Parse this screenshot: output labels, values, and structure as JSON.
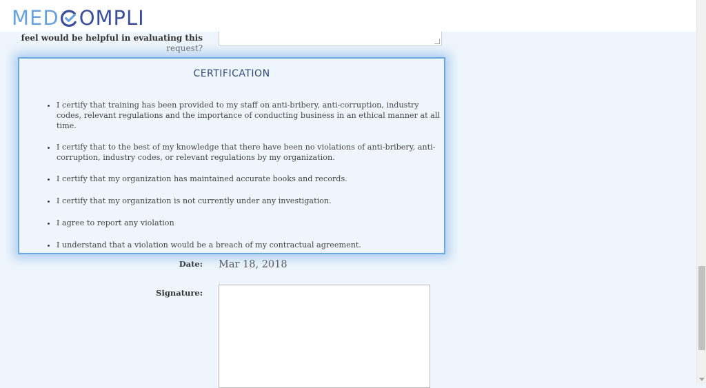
{
  "header": {
    "logo_left": "MED",
    "logo_right": "OMPLI"
  },
  "question": {
    "label_line1": "feel would be helpful in evaluating this",
    "label_line2": "request?"
  },
  "certification": {
    "title": "CERTIFICATION",
    "items": [
      "I certify that training has been provided to my staff on anti-bribery, anti-corruption, industry codes, relevant regulations and the importance of conducting business in an ethical manner at all time.",
      "I certify that to the best of my knowledge that there have been no violations of anti-bribery, anti-corruption, industry codes, or relevant regulations by my organization.",
      "I certify that my organization has maintained accurate books and records.",
      "I certify that my organization is not currently under any investigation.",
      "I agree to report any violation",
      "I understand that a violation would be a breach of my contractual agreement."
    ]
  },
  "form": {
    "date_label": "Date:",
    "date_value": "Mar 18, 2018",
    "signature_label": "Signature:"
  },
  "colors": {
    "brand_light": "#6aa3dc",
    "brand_dark": "#3b4d9b",
    "highlight_border": "#6aa9de"
  }
}
